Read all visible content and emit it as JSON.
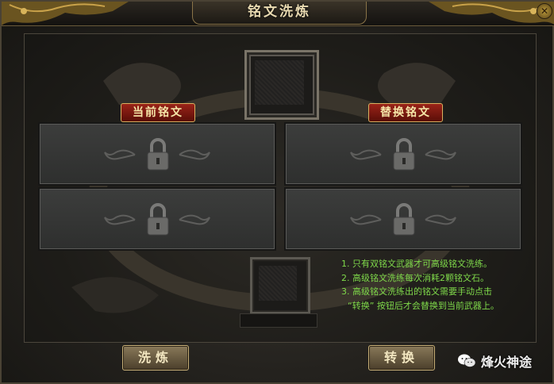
{
  "window": {
    "title": "铭文洗炼",
    "close_label": "✕"
  },
  "labels": {
    "current": "当前铭文",
    "replace": "替换铭文"
  },
  "slots": {
    "current": [
      {
        "state": "locked"
      },
      {
        "state": "locked"
      }
    ],
    "replace": [
      {
        "state": "locked"
      },
      {
        "state": "locked"
      }
    ]
  },
  "tips": [
    "1. 只有双铭文武器才可高级铭文洗练。",
    "2. 高级铭文洗练每次消耗2颗铭文石。",
    "3. 高级铭文洗练出的铭文需要手动点击",
    "“转换” 按钮后才会替换到当前武器上。"
  ],
  "buttons": {
    "refine": "洗炼",
    "swap": "转换"
  },
  "watermark": {
    "text": "烽火神途",
    "icon": "wechat-icon"
  },
  "colors": {
    "tip_text": "#7fd94a",
    "banner": "#9a2418",
    "title_text": "#e8d9b0"
  }
}
